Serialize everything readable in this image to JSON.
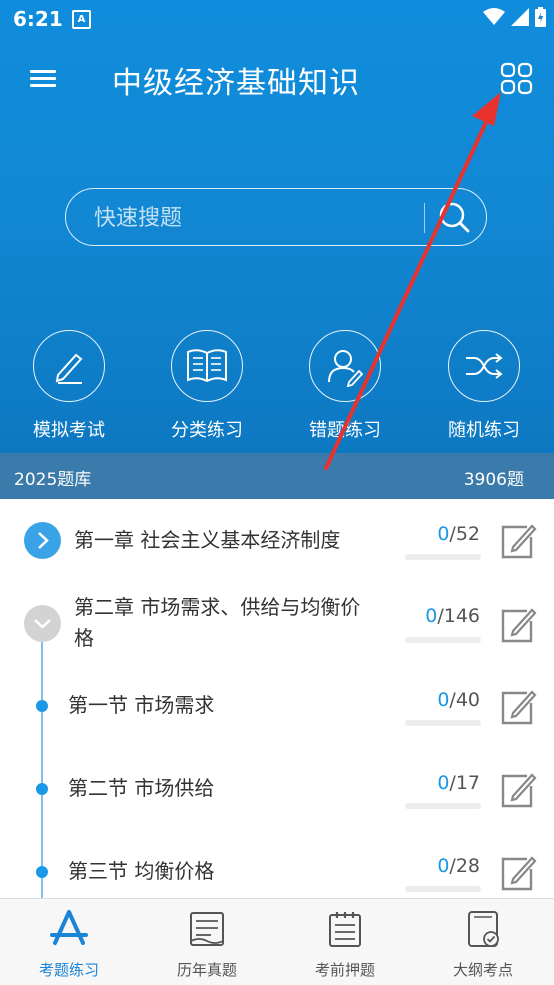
{
  "status": {
    "time": "6:21",
    "notif_badge": "A"
  },
  "header": {
    "title": "中级经济基础知识"
  },
  "search": {
    "placeholder": "快速搜题"
  },
  "actions": [
    {
      "label": "模拟考试",
      "icon": "pencil-icon"
    },
    {
      "label": "分类练习",
      "icon": "book-icon"
    },
    {
      "label": "错题练习",
      "icon": "user-edit-icon"
    },
    {
      "label": "随机练习",
      "icon": "shuffle-icon"
    }
  ],
  "bank": {
    "name": "2025题库",
    "count": "3906题"
  },
  "chapters": [
    {
      "title": "第一章 社会主义基本经济制度",
      "done": "0",
      "total": "/52"
    },
    {
      "title_line1": "第二章 市场需求、供给与均衡价",
      "title_line2": "格",
      "done": "0",
      "total": "/146"
    }
  ],
  "sections": [
    {
      "title": "第一节 市场需求",
      "done": "0",
      "total": "/40"
    },
    {
      "title": "第二节 市场供给",
      "done": "0",
      "total": "/17"
    },
    {
      "title": "第三节 均衡价格",
      "done": "0",
      "total": "/28"
    }
  ],
  "tabs": [
    {
      "label": "考题练习",
      "active": true
    },
    {
      "label": "历年真题"
    },
    {
      "label": "考前押题"
    },
    {
      "label": "大纲考点"
    }
  ],
  "colors": {
    "primary": "#1288d4",
    "accent": "#1a98e6",
    "arrow": "#e8322d"
  }
}
